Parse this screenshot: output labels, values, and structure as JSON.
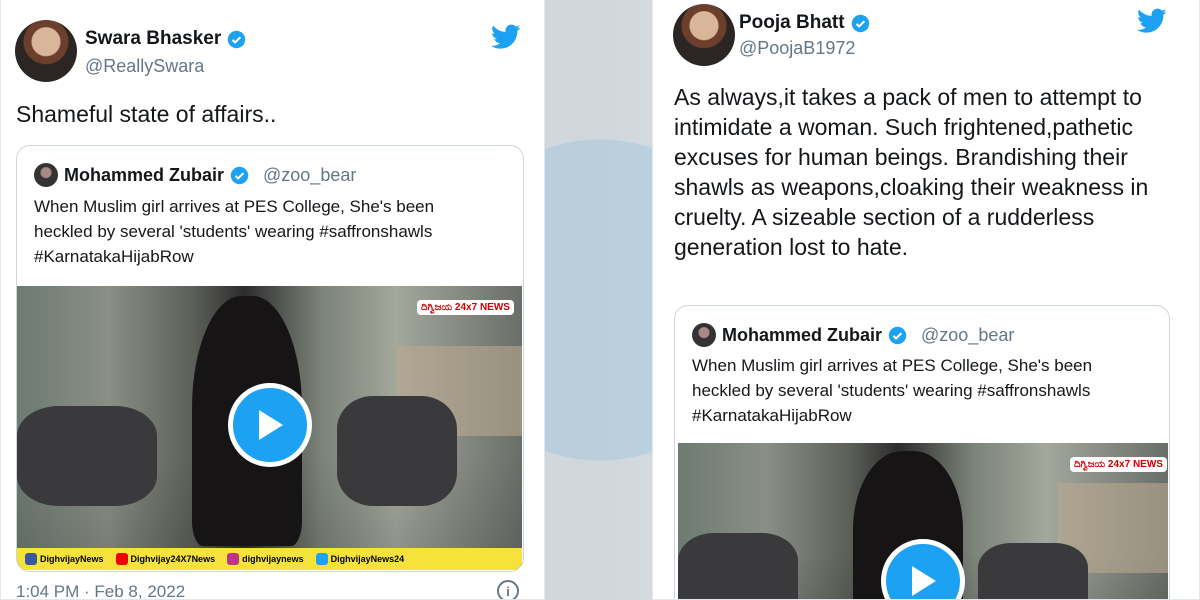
{
  "colors": {
    "twitter_blue": "#1da1f2",
    "text": "#14171a",
    "muted": "#657786",
    "border": "#ccd6dd"
  },
  "left_tweet": {
    "author": {
      "name": "Swara Bhasker",
      "handle": "@ReallySwara",
      "verified": true
    },
    "text": "Shameful state of affairs..",
    "quote": {
      "author": {
        "name": "Mohammed Zubair",
        "handle": "@zoo_bear",
        "verified": true
      },
      "text": "When Muslim girl arrives at PES College, She's been heckled by several 'students' wearing #saffronshawls #KarnatakaHijabRow",
      "video": {
        "channel_logo": "ದಿಗ್ವಿಜಯ 24x7 NEWS",
        "social": [
          {
            "icon": "facebook-icon",
            "label": "DighvijayNews"
          },
          {
            "icon": "youtube-icon",
            "label": "Dighvijay24X7News"
          },
          {
            "icon": "instagram-icon",
            "label": "dighvijaynews"
          },
          {
            "icon": "twitter-icon",
            "label": "DighvijayNews24"
          }
        ]
      }
    },
    "timestamp": "1:04 PM · Feb 8, 2022"
  },
  "right_tweet": {
    "author": {
      "name": "Pooja Bhatt",
      "handle": "@PoojaB1972",
      "verified": true
    },
    "text": "As always,it takes a pack of men to attempt to intimidate a woman. Such frightened,pathetic excuses for human beings. Brandishing their shawls as weapons,cloaking their weakness in cruelty. A sizeable section of a rudderless generation lost to hate.",
    "quote": {
      "author": {
        "name": "Mohammed Zubair",
        "handle": "@zoo_bear",
        "verified": true
      },
      "text": "When Muslim girl arrives at PES College, She's been heckled by several 'students' wearing #saffronshawls #KarnatakaHijabRow",
      "video": {
        "channel_logo": "ದಿಗ್ವಿಜಯ 24x7 NEWS"
      }
    }
  }
}
